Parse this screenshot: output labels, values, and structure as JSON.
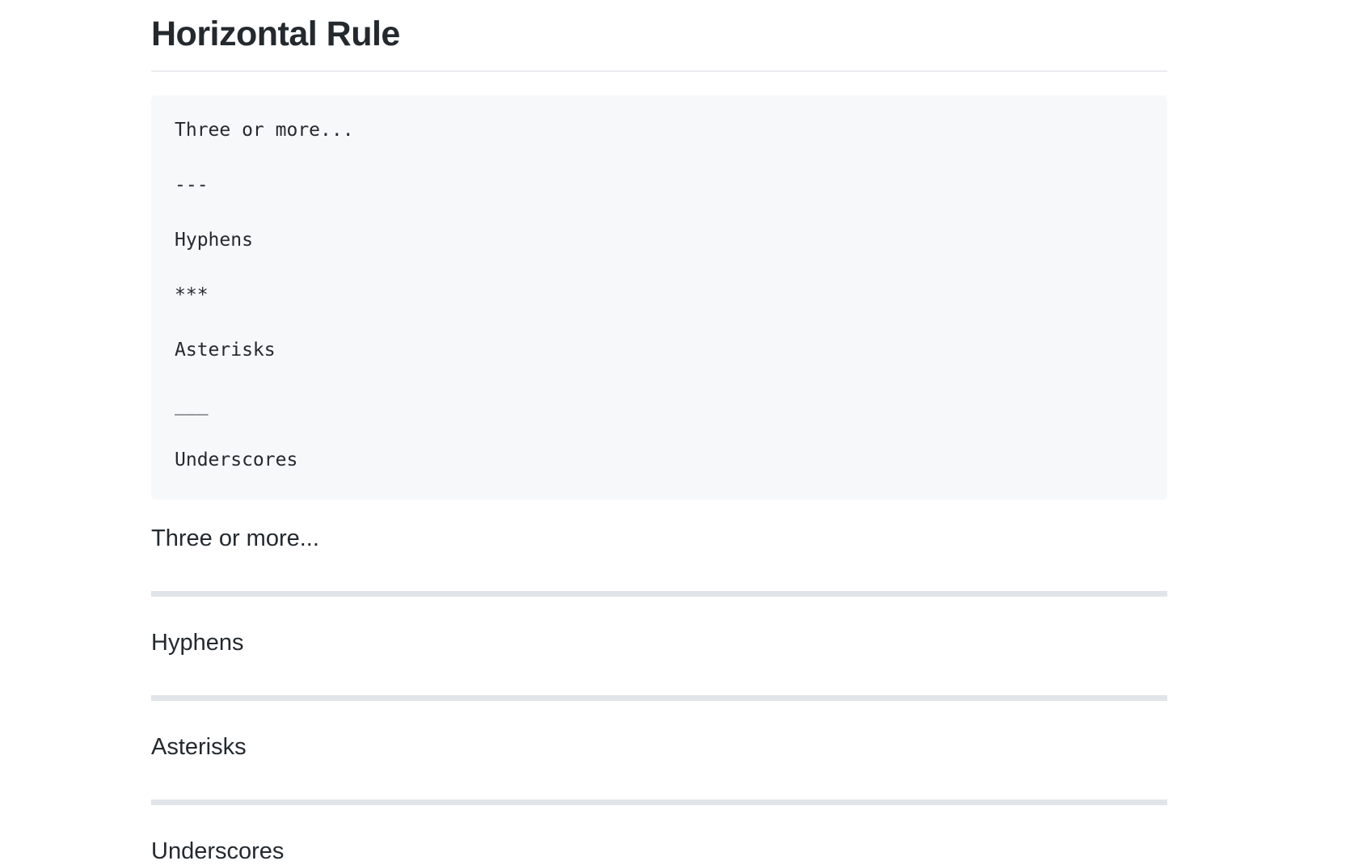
{
  "heading": "Horizontal Rule",
  "code_block": {
    "lines": [
      "Three or more...",
      "---",
      "Hyphens",
      "***",
      "Asterisks",
      "___",
      "Underscores"
    ]
  },
  "rendered": {
    "paragraphs": [
      "Three or more...",
      "Hyphens",
      "Asterisks",
      "Underscores"
    ]
  },
  "colors": {
    "text": "#24292e",
    "code_background": "#f6f8fa",
    "heading_rule": "#eaecef",
    "horizontal_rule": "#e1e4e8"
  }
}
